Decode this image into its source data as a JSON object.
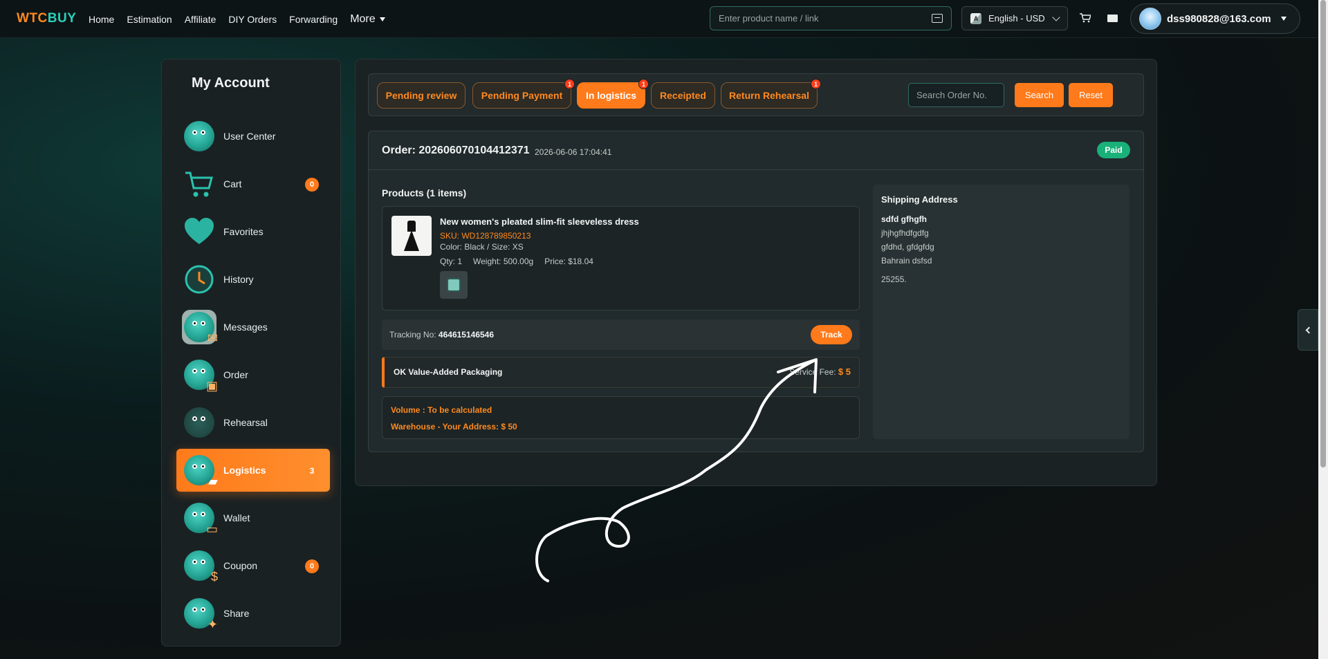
{
  "brand": {
    "w": "W",
    "tc": "TC",
    "buy": "BUY"
  },
  "nav": {
    "home": "Home",
    "estimation": "Estimation",
    "affiliate": "Affiliate",
    "diy": "DIY Orders",
    "forwarding": "Forwarding",
    "more": "More"
  },
  "search": {
    "placeholder": "Enter product name / link"
  },
  "lang": {
    "label": "English - USD"
  },
  "user": {
    "email": "dss980828@163.com"
  },
  "sidebar": {
    "title": "My Account",
    "items": [
      {
        "label": "User Center",
        "badge": ""
      },
      {
        "label": "Cart",
        "badge": "0"
      },
      {
        "label": "Favorites",
        "badge": ""
      },
      {
        "label": "History",
        "badge": ""
      },
      {
        "label": "Messages",
        "badge": ""
      },
      {
        "label": "Order",
        "badge": ""
      },
      {
        "label": "Rehearsal",
        "badge": ""
      },
      {
        "label": "Logistics",
        "badge": "3"
      },
      {
        "label": "Wallet",
        "badge": ""
      },
      {
        "label": "Coupon",
        "badge": "0"
      },
      {
        "label": "Share",
        "badge": ""
      }
    ]
  },
  "tabs": [
    {
      "label": "Pending review",
      "count": ""
    },
    {
      "label": "Pending Payment",
      "count": "1"
    },
    {
      "label": "In logistics",
      "count": "1"
    },
    {
      "label": "Receipted",
      "count": ""
    },
    {
      "label": "Return Rehearsal",
      "count": "1"
    }
  ],
  "order_search": {
    "placeholder": "Search Order No.",
    "search": "Search",
    "reset": "Reset"
  },
  "order": {
    "number": "Order: 202606070104412371",
    "time": "2026-06-06 17:04:41",
    "status": "Paid",
    "products_title": "Products (1 items)",
    "product": {
      "name": "New women's pleated slim-fit sleeveless dress",
      "sku": "SKU: WD128789850213",
      "variant": "Color: Black / Size: XS",
      "qty": "Qty: 1",
      "weight": "Weight: 500.00g",
      "price": "Price: $18.04"
    },
    "tracking": {
      "label": "Tracking No:",
      "value": "464615146546",
      "button": "Track"
    },
    "service": {
      "name": "OK  Value-Added Packaging",
      "fee_label": "Service Fee:",
      "fee_value": "$ 5"
    },
    "volume": "Volume : To be calculated",
    "warehouse": "Warehouse - Your Address: $ 50"
  },
  "shipping": {
    "title": "Shipping Address",
    "name": "sdfd gfhgfh",
    "line1": "jhjhgfhdfgdfg",
    "line2": "gfdhd, gfdgfdg",
    "line3": "Bahrain dsfsd",
    "postcode": "25255."
  },
  "colors": {
    "accent": "#ff7a1a",
    "teal": "#2bd0b9",
    "paid": "#19b07a"
  }
}
